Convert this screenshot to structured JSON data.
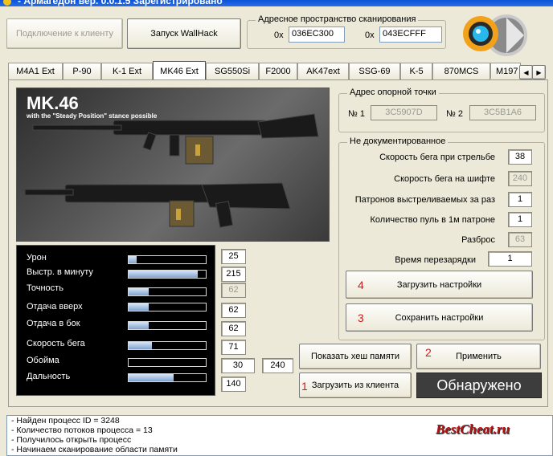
{
  "title": "- Армагедон вер. 0.0.1.5 Зарегистрировано",
  "toolbar": {
    "connect_label": "Подключение к клиенту",
    "wallhack_label": "Запуск WallHack"
  },
  "scan": {
    "legend": "Адресное пространство сканирования",
    "from_prefix": "0x",
    "from_value": "036EC300",
    "to_prefix": "0x",
    "to_value": "043ECFFF"
  },
  "tabs": [
    "M4A1 Ext",
    "P-90",
    "K-1 Ext",
    "MK46 Ext",
    "SG550Si",
    "F2000",
    "AK47ext",
    "SSG-69",
    "K-5",
    "870MCS",
    "M197"
  ],
  "active_tab": "MK46 Ext",
  "weapon_image": {
    "title": "MK.46",
    "subtitle": "with the \"Steady Position\" stance possible"
  },
  "stats": [
    {
      "label": "Урон",
      "value": "25",
      "level": 0.1,
      "enabled": true
    },
    {
      "label": "Выстр. в минуту",
      "value": "215",
      "level": 0.9,
      "enabled": true
    },
    {
      "label": "Точность",
      "value": "62",
      "level": 0.26,
      "enabled": false
    },
    {
      "label": "Отдача вверх",
      "value": "62",
      "level": 0.26,
      "enabled": true
    },
    {
      "label": "Отдача в бок",
      "value": "62",
      "level": 0.26,
      "enabled": true
    },
    {
      "label": "Скорость бега",
      "value": "71",
      "level": 0.3,
      "enabled": true
    },
    {
      "label": "Обойма",
      "value": "30",
      "value2": "240",
      "level": 0.0,
      "enabled": true
    },
    {
      "label": "Дальность",
      "value": "140",
      "level": 0.58,
      "enabled": true
    }
  ],
  "anchor": {
    "legend": "Адрес опорной точки",
    "n1_label": "№ 1",
    "n1_value": "3C5907D",
    "n2_label": "№ 2",
    "n2_value": "3C5B1A6"
  },
  "undoc": {
    "legend": "Не документированное",
    "rows": [
      {
        "label": "Скорость бега при стрельбе",
        "value": "38",
        "enabled": true
      },
      {
        "label": "Скорость бега на шифте",
        "value": "240",
        "enabled": false
      },
      {
        "label": "Патронов выстреливаемых за раз",
        "value": "1",
        "enabled": true
      },
      {
        "label": "Количество пуль в 1м патроне",
        "value": "1",
        "enabled": true
      },
      {
        "label": "Разброс",
        "value": "63",
        "enabled": false
      },
      {
        "label": "Время перезарядки",
        "value": "1",
        "enabled": true
      }
    ],
    "load_settings_label": "Загрузить настройки",
    "load_settings_num": "4",
    "save_settings_label": "Сохранить настройки",
    "save_settings_num": "3"
  },
  "actions": {
    "show_hash_label": "Показать хеш памяти",
    "apply_label": "Применить",
    "apply_num": "2",
    "load_client_label": "Загрузить из клиента",
    "load_client_num": "1",
    "status_label": "Обнаружено"
  },
  "log": [
    "- Найден процесс ID = 3248",
    "- Количество потоков процесса = 13",
    "- Получилось открыть процесс",
    "- Начинаем сканирование области памяти"
  ],
  "watermark": "BestCheat.ru",
  "colors": {
    "accent_red": "#d21818",
    "titlebar": "#0a54d8"
  }
}
